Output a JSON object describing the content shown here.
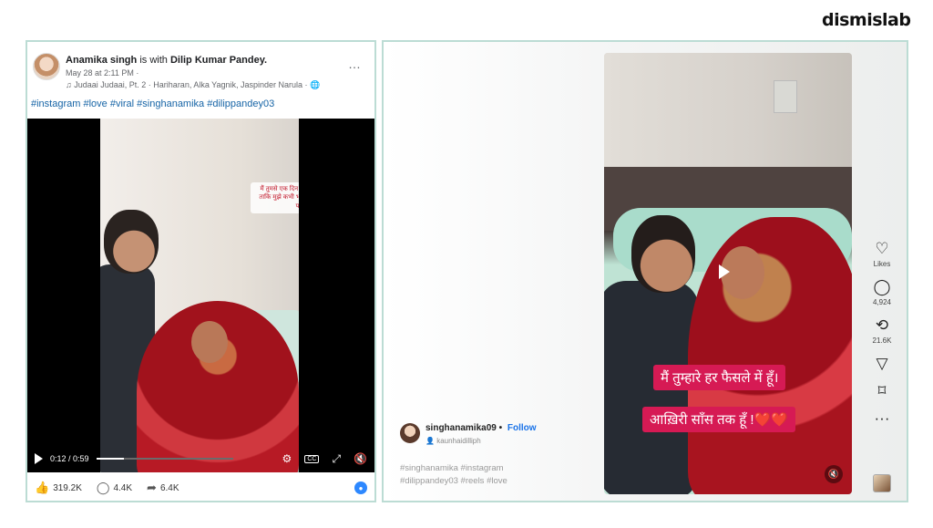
{
  "brand": "dismislab",
  "facebook_post": {
    "author": "Anamika singh",
    "with_text": "is with",
    "tagged": "Dilip Kumar Pandey.",
    "time": "May 28 at 2:11 PM ·",
    "music": "♫ Judaai Judaai, Pt. 2 · Hariharan, Alka Yagnik, Jaspinder Narula · 🌐",
    "hashtags": "#instagram #love #viral #singhanamika #dilippandey03",
    "more_icon": "…",
    "video_caption": "मैं तुमसे एक दिन कम जीना चाहती हूं... ताकि मुझे कभी भी तुम्हारे बिना ना जीना पड़े।❤️",
    "time_current": "0:12 / 0:59",
    "progress_fraction": 0.2,
    "likes": "319.2K",
    "comments": "4.4K",
    "shares": "6.4K"
  },
  "instagram_reel": {
    "username": "singhanamika09",
    "follow": "Follow",
    "audio": "kaunhaidilliph",
    "hashtags_line1": "#singhanamika #instagram",
    "hashtags_line2": "#dilippandey03 #reels #love",
    "caption1": "मैं तुम्हारे हर फैसले में हूँ।",
    "caption2": "आख़िरी साँस तक हूँ !❤️❤️",
    "actions": [
      {
        "icon": "heart-icon",
        "glyph": "♡",
        "label": "Likes"
      },
      {
        "icon": "comment-icon",
        "glyph": "◯",
        "label": "4,924"
      },
      {
        "icon": "repost-icon",
        "glyph": "⟲",
        "label": "21.6K"
      },
      {
        "icon": "send-icon",
        "glyph": "▽",
        "label": ""
      },
      {
        "icon": "bookmark-icon",
        "glyph": "⌑",
        "label": ""
      },
      {
        "icon": "more-icon",
        "glyph": "···",
        "label": ""
      }
    ]
  },
  "colors": {
    "panel_border": "#bcdcd4",
    "fb_link": "#1664a6",
    "ig_caption_bg": "#d61a54",
    "ig_follow": "#1a73e8"
  }
}
